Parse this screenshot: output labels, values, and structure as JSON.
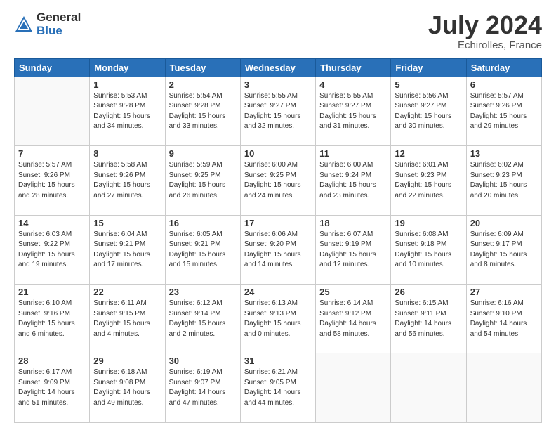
{
  "header": {
    "logo_general": "General",
    "logo_blue": "Blue",
    "title": "July 2024",
    "location": "Echirolles, France"
  },
  "days_of_week": [
    "Sunday",
    "Monday",
    "Tuesday",
    "Wednesday",
    "Thursday",
    "Friday",
    "Saturday"
  ],
  "weeks": [
    [
      {
        "day": "",
        "info": ""
      },
      {
        "day": "1",
        "info": "Sunrise: 5:53 AM\nSunset: 9:28 PM\nDaylight: 15 hours\nand 34 minutes."
      },
      {
        "day": "2",
        "info": "Sunrise: 5:54 AM\nSunset: 9:28 PM\nDaylight: 15 hours\nand 33 minutes."
      },
      {
        "day": "3",
        "info": "Sunrise: 5:55 AM\nSunset: 9:27 PM\nDaylight: 15 hours\nand 32 minutes."
      },
      {
        "day": "4",
        "info": "Sunrise: 5:55 AM\nSunset: 9:27 PM\nDaylight: 15 hours\nand 31 minutes."
      },
      {
        "day": "5",
        "info": "Sunrise: 5:56 AM\nSunset: 9:27 PM\nDaylight: 15 hours\nand 30 minutes."
      },
      {
        "day": "6",
        "info": "Sunrise: 5:57 AM\nSunset: 9:26 PM\nDaylight: 15 hours\nand 29 minutes."
      }
    ],
    [
      {
        "day": "7",
        "info": "Sunrise: 5:57 AM\nSunset: 9:26 PM\nDaylight: 15 hours\nand 28 minutes."
      },
      {
        "day": "8",
        "info": "Sunrise: 5:58 AM\nSunset: 9:26 PM\nDaylight: 15 hours\nand 27 minutes."
      },
      {
        "day": "9",
        "info": "Sunrise: 5:59 AM\nSunset: 9:25 PM\nDaylight: 15 hours\nand 26 minutes."
      },
      {
        "day": "10",
        "info": "Sunrise: 6:00 AM\nSunset: 9:25 PM\nDaylight: 15 hours\nand 24 minutes."
      },
      {
        "day": "11",
        "info": "Sunrise: 6:00 AM\nSunset: 9:24 PM\nDaylight: 15 hours\nand 23 minutes."
      },
      {
        "day": "12",
        "info": "Sunrise: 6:01 AM\nSunset: 9:23 PM\nDaylight: 15 hours\nand 22 minutes."
      },
      {
        "day": "13",
        "info": "Sunrise: 6:02 AM\nSunset: 9:23 PM\nDaylight: 15 hours\nand 20 minutes."
      }
    ],
    [
      {
        "day": "14",
        "info": "Sunrise: 6:03 AM\nSunset: 9:22 PM\nDaylight: 15 hours\nand 19 minutes."
      },
      {
        "day": "15",
        "info": "Sunrise: 6:04 AM\nSunset: 9:21 PM\nDaylight: 15 hours\nand 17 minutes."
      },
      {
        "day": "16",
        "info": "Sunrise: 6:05 AM\nSunset: 9:21 PM\nDaylight: 15 hours\nand 15 minutes."
      },
      {
        "day": "17",
        "info": "Sunrise: 6:06 AM\nSunset: 9:20 PM\nDaylight: 15 hours\nand 14 minutes."
      },
      {
        "day": "18",
        "info": "Sunrise: 6:07 AM\nSunset: 9:19 PM\nDaylight: 15 hours\nand 12 minutes."
      },
      {
        "day": "19",
        "info": "Sunrise: 6:08 AM\nSunset: 9:18 PM\nDaylight: 15 hours\nand 10 minutes."
      },
      {
        "day": "20",
        "info": "Sunrise: 6:09 AM\nSunset: 9:17 PM\nDaylight: 15 hours\nand 8 minutes."
      }
    ],
    [
      {
        "day": "21",
        "info": "Sunrise: 6:10 AM\nSunset: 9:16 PM\nDaylight: 15 hours\nand 6 minutes."
      },
      {
        "day": "22",
        "info": "Sunrise: 6:11 AM\nSunset: 9:15 PM\nDaylight: 15 hours\nand 4 minutes."
      },
      {
        "day": "23",
        "info": "Sunrise: 6:12 AM\nSunset: 9:14 PM\nDaylight: 15 hours\nand 2 minutes."
      },
      {
        "day": "24",
        "info": "Sunrise: 6:13 AM\nSunset: 9:13 PM\nDaylight: 15 hours\nand 0 minutes."
      },
      {
        "day": "25",
        "info": "Sunrise: 6:14 AM\nSunset: 9:12 PM\nDaylight: 14 hours\nand 58 minutes."
      },
      {
        "day": "26",
        "info": "Sunrise: 6:15 AM\nSunset: 9:11 PM\nDaylight: 14 hours\nand 56 minutes."
      },
      {
        "day": "27",
        "info": "Sunrise: 6:16 AM\nSunset: 9:10 PM\nDaylight: 14 hours\nand 54 minutes."
      }
    ],
    [
      {
        "day": "28",
        "info": "Sunrise: 6:17 AM\nSunset: 9:09 PM\nDaylight: 14 hours\nand 51 minutes."
      },
      {
        "day": "29",
        "info": "Sunrise: 6:18 AM\nSunset: 9:08 PM\nDaylight: 14 hours\nand 49 minutes."
      },
      {
        "day": "30",
        "info": "Sunrise: 6:19 AM\nSunset: 9:07 PM\nDaylight: 14 hours\nand 47 minutes."
      },
      {
        "day": "31",
        "info": "Sunrise: 6:21 AM\nSunset: 9:05 PM\nDaylight: 14 hours\nand 44 minutes."
      },
      {
        "day": "",
        "info": ""
      },
      {
        "day": "",
        "info": ""
      },
      {
        "day": "",
        "info": ""
      }
    ]
  ]
}
